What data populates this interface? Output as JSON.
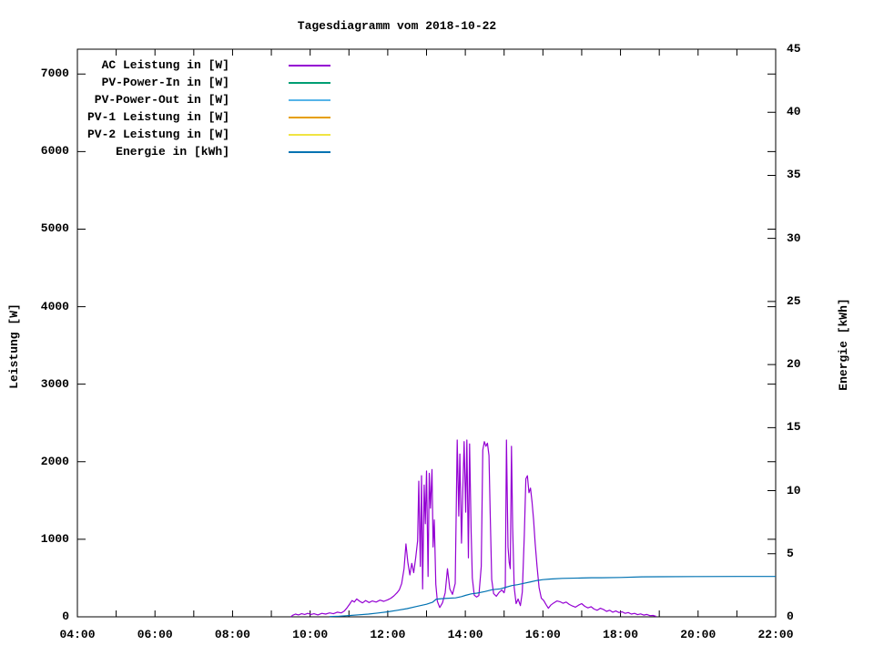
{
  "chart_data": {
    "type": "line",
    "title": "Tagesdiagramm vom 2018-10-22",
    "xlabel": "",
    "ylabel": "Leistung [W]",
    "y2label": "Energie [kWh]",
    "grid": false,
    "legend_position": "top-left-inside",
    "x_range_hours": [
      4,
      22
    ],
    "x_ticks": [
      {
        "hour": 4,
        "label": "04:00"
      },
      {
        "hour": 6,
        "label": "06:00"
      },
      {
        "hour": 8,
        "label": "08:00"
      },
      {
        "hour": 10,
        "label": "10:00"
      },
      {
        "hour": 12,
        "label": "12:00"
      },
      {
        "hour": 14,
        "label": "14:00"
      },
      {
        "hour": 16,
        "label": "16:00"
      },
      {
        "hour": 18,
        "label": "18:00"
      },
      {
        "hour": 20,
        "label": "20:00"
      },
      {
        "hour": 22,
        "label": "22:00"
      }
    ],
    "x_minor_tick_hours": [
      5,
      7,
      9,
      11,
      13,
      15,
      17,
      19,
      21
    ],
    "y_axis": {
      "label": "Leistung [W]",
      "ticks": [
        0,
        1000,
        2000,
        3000,
        4000,
        5000,
        6000,
        7000
      ],
      "range": [
        0,
        7320
      ]
    },
    "y2_axis": {
      "label": "Energie [kWh]",
      "ticks": [
        0,
        5,
        10,
        15,
        20,
        25,
        30,
        35,
        40,
        45
      ],
      "range": [
        0,
        45
      ]
    },
    "axis_color": "#000000",
    "series": [
      {
        "name": "AC Leistung in [W]",
        "slug": "ac-leistung",
        "color": "#9400d3",
        "axis": "y",
        "points": [
          [
            9.5,
            0
          ],
          [
            9.55,
            20
          ],
          [
            9.62,
            35
          ],
          [
            9.7,
            25
          ],
          [
            9.78,
            40
          ],
          [
            9.86,
            30
          ],
          [
            9.94,
            45
          ],
          [
            10.02,
            30
          ],
          [
            10.1,
            40
          ],
          [
            10.2,
            25
          ],
          [
            10.3,
            45
          ],
          [
            10.4,
            35
          ],
          [
            10.5,
            50
          ],
          [
            10.6,
            40
          ],
          [
            10.7,
            60
          ],
          [
            10.8,
            50
          ],
          [
            10.88,
            75
          ],
          [
            10.95,
            115
          ],
          [
            11.02,
            165
          ],
          [
            11.08,
            210
          ],
          [
            11.14,
            190
          ],
          [
            11.2,
            230
          ],
          [
            11.28,
            200
          ],
          [
            11.35,
            180
          ],
          [
            11.43,
            210
          ],
          [
            11.52,
            185
          ],
          [
            11.6,
            205
          ],
          [
            11.7,
            190
          ],
          [
            11.8,
            215
          ],
          [
            11.9,
            200
          ],
          [
            12.0,
            220
          ],
          [
            12.08,
            240
          ],
          [
            12.16,
            270
          ],
          [
            12.24,
            310
          ],
          [
            12.3,
            350
          ],
          [
            12.36,
            430
          ],
          [
            12.42,
            620
          ],
          [
            12.47,
            940
          ],
          [
            12.52,
            700
          ],
          [
            12.57,
            540
          ],
          [
            12.62,
            690
          ],
          [
            12.67,
            570
          ],
          [
            12.72,
            760
          ],
          [
            12.77,
            980
          ],
          [
            12.8,
            1750
          ],
          [
            12.84,
            650
          ],
          [
            12.87,
            1820
          ],
          [
            12.9,
            360
          ],
          [
            12.94,
            1700
          ],
          [
            12.97,
            1200
          ],
          [
            13.0,
            1880
          ],
          [
            13.04,
            520
          ],
          [
            13.07,
            1850
          ],
          [
            13.1,
            1400
          ],
          [
            13.14,
            1900
          ],
          [
            13.17,
            900
          ],
          [
            13.2,
            1250
          ],
          [
            13.24,
            420
          ],
          [
            13.28,
            200
          ],
          [
            13.34,
            120
          ],
          [
            13.41,
            180
          ],
          [
            13.48,
            310
          ],
          [
            13.54,
            620
          ],
          [
            13.6,
            360
          ],
          [
            13.67,
            290
          ],
          [
            13.74,
            430
          ],
          [
            13.79,
            2280
          ],
          [
            13.83,
            1300
          ],
          [
            13.86,
            2100
          ],
          [
            13.9,
            950
          ],
          [
            13.94,
            1750
          ],
          [
            13.97,
            2260
          ],
          [
            14.01,
            1350
          ],
          [
            14.04,
            2280
          ],
          [
            14.08,
            760
          ],
          [
            14.11,
            2230
          ],
          [
            14.15,
            1100
          ],
          [
            14.18,
            500
          ],
          [
            14.23,
            280
          ],
          [
            14.29,
            255
          ],
          [
            14.35,
            275
          ],
          [
            14.41,
            650
          ],
          [
            14.45,
            2150
          ],
          [
            14.49,
            2260
          ],
          [
            14.53,
            2200
          ],
          [
            14.57,
            2240
          ],
          [
            14.61,
            2080
          ],
          [
            14.64,
            1350
          ],
          [
            14.68,
            480
          ],
          [
            14.73,
            300
          ],
          [
            14.8,
            265
          ],
          [
            14.87,
            315
          ],
          [
            14.94,
            345
          ],
          [
            15.0,
            310
          ],
          [
            15.03,
            380
          ],
          [
            15.06,
            2280
          ],
          [
            15.1,
            900
          ],
          [
            15.13,
            700
          ],
          [
            15.16,
            620
          ],
          [
            15.19,
            2200
          ],
          [
            15.22,
            1150
          ],
          [
            15.26,
            380
          ],
          [
            15.31,
            170
          ],
          [
            15.36,
            230
          ],
          [
            15.42,
            145
          ],
          [
            15.47,
            320
          ],
          [
            15.52,
            1050
          ],
          [
            15.56,
            1780
          ],
          [
            15.6,
            1820
          ],
          [
            15.64,
            1600
          ],
          [
            15.68,
            1660
          ],
          [
            15.72,
            1480
          ],
          [
            15.76,
            1250
          ],
          [
            15.8,
            950
          ],
          [
            15.85,
            650
          ],
          [
            15.9,
            380
          ],
          [
            15.96,
            240
          ],
          [
            16.02,
            210
          ],
          [
            16.08,
            160
          ],
          [
            16.14,
            110
          ],
          [
            16.2,
            150
          ],
          [
            16.28,
            180
          ],
          [
            16.36,
            205
          ],
          [
            16.44,
            195
          ],
          [
            16.52,
            175
          ],
          [
            16.6,
            190
          ],
          [
            16.68,
            160
          ],
          [
            16.76,
            140
          ],
          [
            16.84,
            125
          ],
          [
            16.92,
            150
          ],
          [
            17.0,
            170
          ],
          [
            17.08,
            135
          ],
          [
            17.16,
            115
          ],
          [
            17.24,
            130
          ],
          [
            17.32,
            100
          ],
          [
            17.4,
            85
          ],
          [
            17.48,
            110
          ],
          [
            17.56,
            95
          ],
          [
            17.64,
            70
          ],
          [
            17.72,
            85
          ],
          [
            17.8,
            60
          ],
          [
            17.88,
            75
          ],
          [
            17.96,
            55
          ],
          [
            18.04,
            65
          ],
          [
            18.12,
            45
          ],
          [
            18.2,
            55
          ],
          [
            18.28,
            35
          ],
          [
            18.36,
            45
          ],
          [
            18.44,
            28
          ],
          [
            18.52,
            38
          ],
          [
            18.6,
            22
          ],
          [
            18.68,
            30
          ],
          [
            18.76,
            15
          ],
          [
            18.84,
            18
          ],
          [
            18.92,
            5
          ]
        ]
      },
      {
        "name": "PV-Power-In in [W]",
        "slug": "pv-power-in",
        "color": "#009e73",
        "axis": "y",
        "points": []
      },
      {
        "name": "PV-Power-Out in [W]",
        "slug": "pv-power-out",
        "color": "#56b4e9",
        "axis": "y",
        "points": []
      },
      {
        "name": "PV-1 Leistung in [W]",
        "slug": "pv-1-leistung",
        "color": "#e69f00",
        "axis": "y",
        "points": []
      },
      {
        "name": "PV-2 Leistung in [W]",
        "slug": "pv-2-leistung",
        "color": "#f0e442",
        "axis": "y",
        "points": []
      },
      {
        "name": "Energie in [kWh]",
        "slug": "energie",
        "color": "#0072b2",
        "axis": "y2",
        "points": [
          [
            10.5,
            0.02
          ],
          [
            10.75,
            0.05
          ],
          [
            11.0,
            0.1
          ],
          [
            11.25,
            0.16
          ],
          [
            11.5,
            0.22
          ],
          [
            11.75,
            0.3
          ],
          [
            12.0,
            0.4
          ],
          [
            12.25,
            0.52
          ],
          [
            12.5,
            0.65
          ],
          [
            12.75,
            0.82
          ],
          [
            13.0,
            1.0
          ],
          [
            13.15,
            1.15
          ],
          [
            13.25,
            1.4
          ],
          [
            13.45,
            1.45
          ],
          [
            13.75,
            1.5
          ],
          [
            13.9,
            1.6
          ],
          [
            14.0,
            1.7
          ],
          [
            14.15,
            1.82
          ],
          [
            14.3,
            1.88
          ],
          [
            14.5,
            2.0
          ],
          [
            14.7,
            2.15
          ],
          [
            14.9,
            2.22
          ],
          [
            15.05,
            2.35
          ],
          [
            15.2,
            2.48
          ],
          [
            15.35,
            2.55
          ],
          [
            15.5,
            2.65
          ],
          [
            15.7,
            2.78
          ],
          [
            15.85,
            2.88
          ],
          [
            16.0,
            2.95
          ],
          [
            16.2,
            3.0
          ],
          [
            16.5,
            3.05
          ],
          [
            17.0,
            3.08
          ],
          [
            17.25,
            3.1
          ],
          [
            17.5,
            3.1
          ],
          [
            18.0,
            3.12
          ],
          [
            18.55,
            3.17
          ],
          [
            19.0,
            3.18
          ],
          [
            20.0,
            3.19
          ],
          [
            21.0,
            3.2
          ],
          [
            22.0,
            3.2
          ]
        ]
      }
    ]
  }
}
